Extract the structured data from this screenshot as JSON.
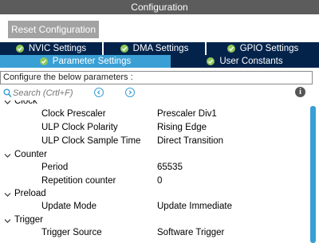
{
  "window": {
    "title": "Configuration"
  },
  "toolbar": {
    "reset_label": "Reset Configuration"
  },
  "tabs_row1": [
    {
      "label": "NVIC Settings"
    },
    {
      "label": "DMA Settings"
    },
    {
      "label": "GPIO Settings"
    }
  ],
  "tabs_row2": [
    {
      "label": "Parameter Settings",
      "active": true
    },
    {
      "label": "User Constants",
      "active": false
    }
  ],
  "colors": {
    "title_bg": "#5c5c5c",
    "tab_dark": "#03234b",
    "tab_active": "#3a9fd4",
    "check_green": "#8fc85a"
  },
  "panel": {
    "config_text": "Configure the below parameters :",
    "search_placeholder": "Search (Crtl+F)",
    "icons": [
      "search-icon",
      "prev-arrow-icon",
      "next-arrow-icon",
      "info-icon"
    ]
  },
  "tree": [
    {
      "group": "Clock",
      "params": [
        {
          "name": "Clock Prescaler",
          "value": "Prescaler Div1"
        },
        {
          "name": "ULP Clock Polarity",
          "value": "Rising Edge"
        },
        {
          "name": "ULP Clock Sample Time",
          "value": "Direct Transition"
        }
      ]
    },
    {
      "group": "Counter",
      "params": [
        {
          "name": "Period",
          "value": "65535"
        },
        {
          "name": "Repetition counter",
          "value": "0"
        }
      ]
    },
    {
      "group": "Preload",
      "params": [
        {
          "name": "Update Mode",
          "value": "Update Immediate"
        }
      ]
    },
    {
      "group": "Trigger",
      "params": [
        {
          "name": "Trigger Source",
          "value": "Software Trigger"
        }
      ]
    }
  ]
}
